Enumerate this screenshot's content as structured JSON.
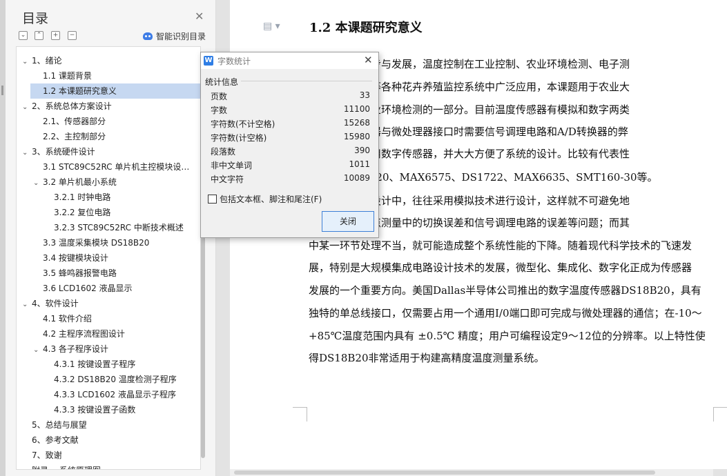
{
  "toc": {
    "title": "目录",
    "smart_label": "智能识别目录",
    "toolbar_glyphs": [
      "⌄",
      "⌃",
      "+",
      "−"
    ],
    "items": [
      {
        "label": "1、绪论",
        "level": 0,
        "arrow": "⌄"
      },
      {
        "label": "1.1 课题背景",
        "level": 1,
        "arrow": ""
      },
      {
        "label": "1.2  本课题研究意义",
        "level": 1,
        "arrow": "",
        "selected": true
      },
      {
        "label": "2、系统总体方案设计",
        "level": 0,
        "arrow": "⌄"
      },
      {
        "label": "2.1、传感器部分",
        "level": 1,
        "arrow": ""
      },
      {
        "label": "2.2、主控制部分",
        "level": 1,
        "arrow": ""
      },
      {
        "label": "3、系统硬件设计",
        "level": 0,
        "arrow": "⌄"
      },
      {
        "label": "3.1 STC89C52RC 单片机主控模块设…",
        "level": 1,
        "arrow": ""
      },
      {
        "label": "3.2 单片机最小系统",
        "level": 1,
        "arrow": "⌄"
      },
      {
        "label": "3.2.1 时钟电路",
        "level": 2,
        "arrow": ""
      },
      {
        "label": "3.2.2 复位电路",
        "level": 2,
        "arrow": ""
      },
      {
        "label": "3.2.3 STC89C52RC 中断技术概述",
        "level": 2,
        "arrow": ""
      },
      {
        "label": "3.3  温度采集模块 DS18B20",
        "level": 1,
        "arrow": ""
      },
      {
        "label": "3.4 按键模块设计",
        "level": 1,
        "arrow": ""
      },
      {
        "label": "3.5 蜂鸣器报警电路",
        "level": 1,
        "arrow": ""
      },
      {
        "label": "3.6 LCD1602 液晶显示",
        "level": 1,
        "arrow": ""
      },
      {
        "label": "4、软件设计",
        "level": 0,
        "arrow": "⌄"
      },
      {
        "label": "4.1 软件介绍",
        "level": 1,
        "arrow": ""
      },
      {
        "label": "4.2  主程序流程图设计",
        "level": 1,
        "arrow": ""
      },
      {
        "label": "4.3 各子程序设计",
        "level": 1,
        "arrow": "⌄"
      },
      {
        "label": "4.3.1 按键设置子程序",
        "level": 2,
        "arrow": ""
      },
      {
        "label": "4.3.2 DS18B20 温度检测子程序",
        "level": 2,
        "arrow": ""
      },
      {
        "label": "4.3.3 LCD1602 液晶显示子程序",
        "level": 2,
        "arrow": ""
      },
      {
        "label": "4.3.3  按键设置子函数",
        "level": 2,
        "arrow": ""
      },
      {
        "label": "5、总结与展望",
        "level": 0,
        "arrow": ""
      },
      {
        "label": "6、参考文献",
        "level": 0,
        "arrow": ""
      },
      {
        "label": "7、致谢",
        "level": 0,
        "arrow": ""
      },
      {
        "label": "附录一  系统原理图",
        "level": 0,
        "arrow": ""
      }
    ]
  },
  "doc": {
    "heading": "1.2  本课题研究意义",
    "lines": [
      "技术的不断进步与发展，温度控制在工业控制、农业环境检测、电子测",
      "器、家用电器等各种花卉养殖监控系统中广泛应用，本课题用于农业大",
      "显然是用在农业环境检测的一部分。目前温度传感器有模拟和数字两类",
      "克服模拟传感器与微处理器接口时需要信号调理电路和A/D转换器的弊",
      "温控制系统采用数字传感器，并大大方便了系统的设计。比较有代表性",
      "感器有DS18B20、MAX6575、DS1722、MAX6635、SMT160-30等。",
      "温度测量系统设计中，往往采用模拟技术进行设计，这样就不可避免地",
      "误差补偿、多点测量中的切换误差和信号调理电路的误差等问题；而其",
      "中某一环节处理不当，就可能造成整个系统性能的下降。随着现代科学技术的飞速发",
      "展，特别是大规模集成电路设计技术的发展，微型化、集成化、数字化正成为传感器",
      "发展的一个重要方向。美国Dallas半导体公司推出的数字温度传感器DS18B20，具有",
      "独特的单总线接口，仅需要占用一个通用I/0端口即可完成与微处理器的通信；在-10～",
      "+85℃温度范围内具有 ±0.5℃  精度；用户可编程设定9～12位的分辨率。以上特性使",
      "得DS18B20非常适用于构建高精度温度测量系统。"
    ]
  },
  "dialog": {
    "title": "字数统计",
    "group_label": "统计信息",
    "stats": [
      {
        "label": "页数",
        "value": "33"
      },
      {
        "label": "字数",
        "value": "11100"
      },
      {
        "label": "字符数(不计空格)",
        "value": "15268"
      },
      {
        "label": "字符数(计空格)",
        "value": "15980"
      },
      {
        "label": "段落数",
        "value": "390"
      },
      {
        "label": "非中文单词",
        "value": "1011"
      },
      {
        "label": "中文字符",
        "value": "10089"
      }
    ],
    "checkbox_label": "包括文本框、脚注和尾注(F)",
    "close_button": "关闭"
  }
}
